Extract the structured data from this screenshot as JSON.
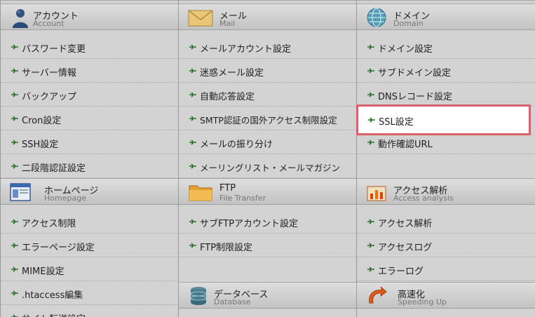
{
  "columns": [
    {
      "sections": [
        {
          "title": "アカウント",
          "subtitle": "Account",
          "icon": "account-icon",
          "items": [
            "パスワード変更",
            "サーバー情報",
            "バックアップ",
            "Cron設定",
            "SSH設定",
            "二段階認証設定"
          ]
        },
        {
          "title": "ホームページ",
          "subtitle": "Homepage",
          "icon": "homepage-icon",
          "items": [
            "アクセス制限",
            "エラーページ設定",
            "MIME設定",
            ".htaccess編集",
            "サイト転送設定"
          ]
        }
      ]
    },
    {
      "sections": [
        {
          "title": "メール",
          "subtitle": "Mail",
          "icon": "mail-icon",
          "items": [
            "メールアカウント設定",
            "迷惑メール設定",
            "自動応答設定",
            "SMTP認証の国外アクセス制限設定",
            "メールの振り分け",
            "メーリングリスト・メールマガジン"
          ]
        },
        {
          "title": "FTP",
          "subtitle": "File Transfer",
          "icon": "folder-icon",
          "items": [
            "サブFTPアカウント設定",
            "FTP制限設定"
          ]
        },
        {
          "title": "データベース",
          "subtitle": "Database",
          "icon": "database-icon",
          "items": []
        }
      ]
    },
    {
      "sections": [
        {
          "title": "ドメイン",
          "subtitle": "Domain",
          "icon": "globe-icon",
          "items": [
            "ドメイン設定",
            "サブドメイン設定",
            "DNSレコード設定",
            "SSL設定",
            "動作確認URL"
          ]
        },
        {
          "title": "アクセス解析",
          "subtitle": "Access analysis",
          "icon": "analytics-icon",
          "items": [
            "アクセス解析",
            "アクセスログ",
            "エラーログ"
          ]
        },
        {
          "title": "高速化",
          "subtitle": "Speeding Up",
          "icon": "speed-icon",
          "items": []
        }
      ]
    }
  ],
  "highlighted_item": "SSL設定",
  "colors": {
    "highlight_border": "#d9636b",
    "overlay_gray": "#d3d3d3"
  }
}
